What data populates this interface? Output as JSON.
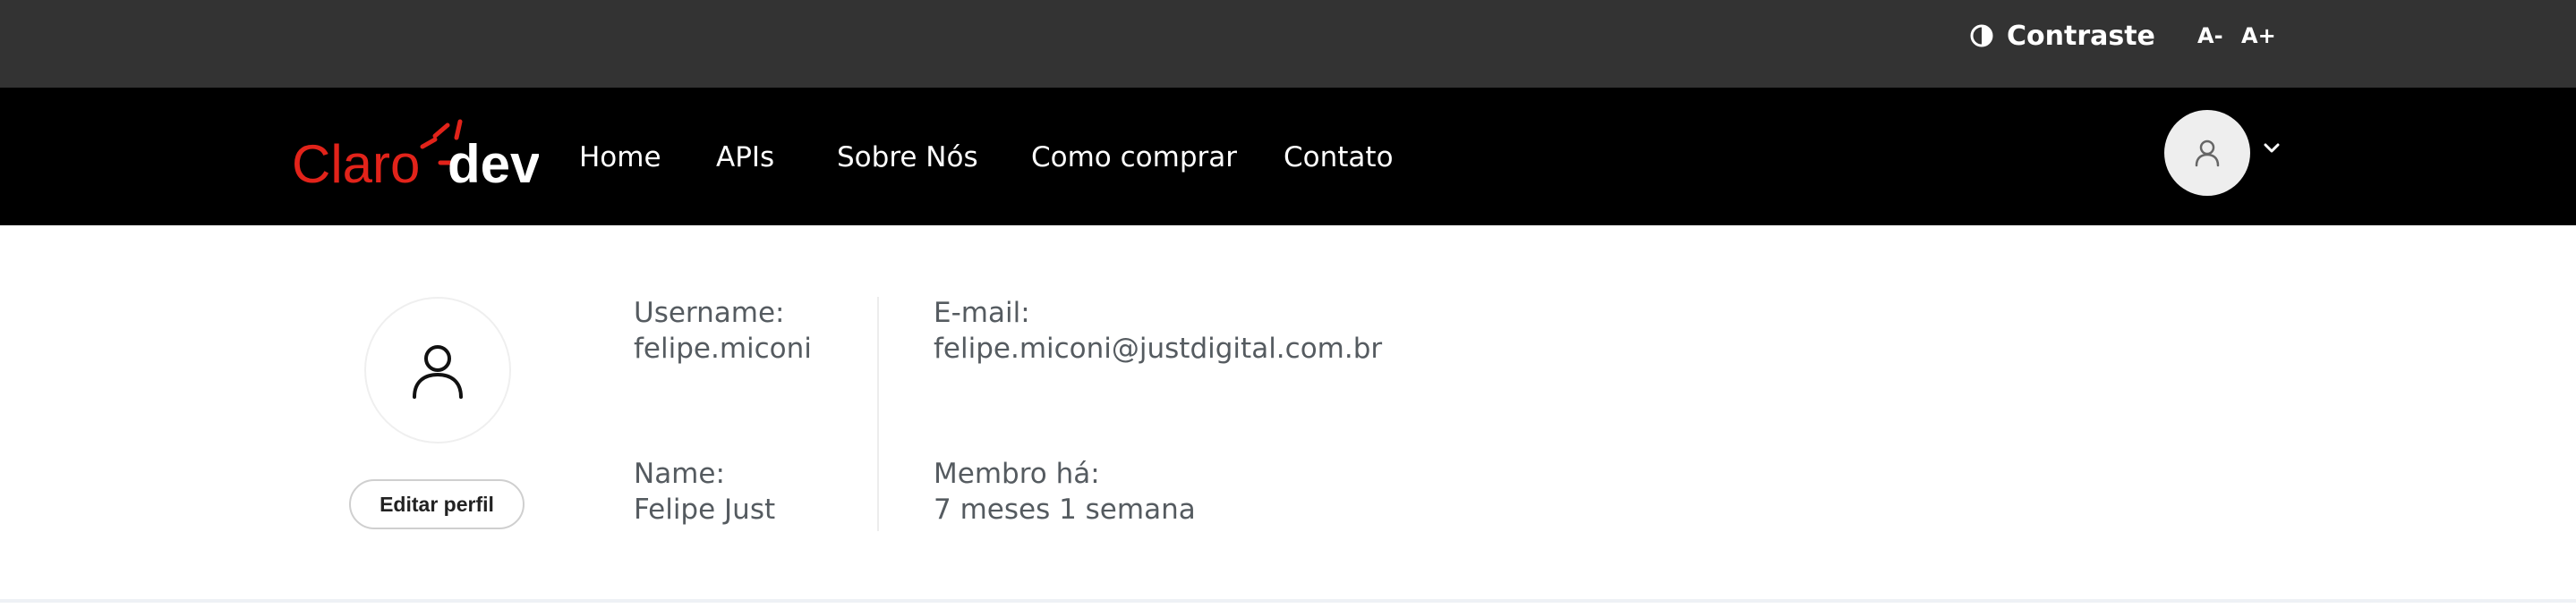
{
  "topbar": {
    "contrast_label": "Contraste",
    "font_decrease": "A-",
    "font_increase": "A+"
  },
  "navbar": {
    "logo": {
      "brand": "Claro",
      "suffix": "dev",
      "accent": "#e2231a"
    },
    "items": [
      {
        "label": "Home"
      },
      {
        "label": "APIs"
      },
      {
        "label": "Sobre Nós"
      },
      {
        "label": "Como comprar"
      },
      {
        "label": "Contato"
      }
    ]
  },
  "profile": {
    "edit_button": "Editar perfil",
    "username_label": "Username:",
    "username_value": "felipe.miconi",
    "email_label": "E-mail:",
    "email_value": "felipe.miconi@justdigital.com.br",
    "name_label": "Name:",
    "name_value": "Felipe Just",
    "member_label": "Membro há:",
    "member_value": "7 meses 1 semana"
  },
  "icons": {
    "contrast": "contrast-icon",
    "avatar": "user-icon",
    "dropdown": "chevron-down-icon"
  },
  "colors": {
    "topbar": "#333333",
    "navbar": "#000000",
    "accent": "#e2231a",
    "text_muted": "#555b60"
  }
}
